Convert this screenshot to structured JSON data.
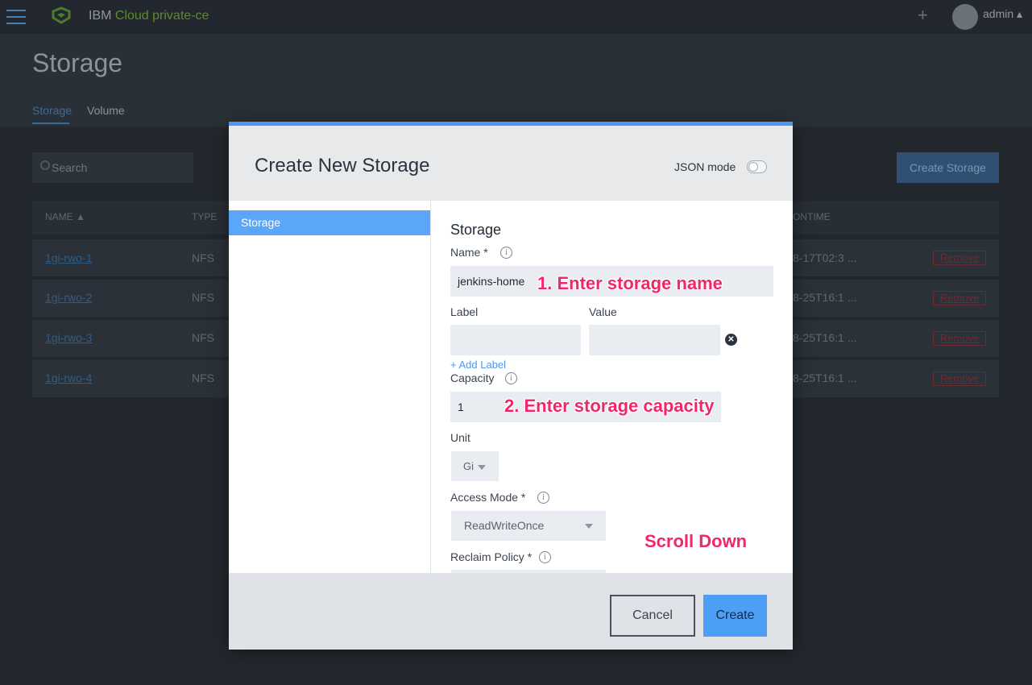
{
  "app": {
    "brand_prefix": "IBM ",
    "brand_name": "Cloud private-ce",
    "username": "admin",
    "plus_glyph": "+"
  },
  "page": {
    "title": "Storage",
    "tabs": [
      {
        "label": "Storage",
        "active": true
      },
      {
        "label": "Volume",
        "active": false
      }
    ],
    "search": {
      "placeholder": "Search"
    },
    "create_button": "Create Storage",
    "table": {
      "columns": [
        "NAME ▲",
        "TYPE",
        "ONTIME"
      ],
      "rows": [
        {
          "name": "1gi-rwo-1",
          "type": "NFS",
          "time": "8-17T02:3 ...",
          "action": "Remove"
        },
        {
          "name": "1gi-rwo-2",
          "type": "NFS",
          "time": "8-25T16:1 ...",
          "action": "Remove"
        },
        {
          "name": "1gi-rwo-3",
          "type": "NFS",
          "time": "8-25T16:1 ...",
          "action": "Remove"
        },
        {
          "name": "1gi-rwo-4",
          "type": "NFS",
          "time": "8-25T16:1 ...",
          "action": "Remove"
        }
      ]
    }
  },
  "modal": {
    "title": "Create New Storage",
    "json_mode_label": "JSON mode",
    "json_mode_on": false,
    "sidebar_items": [
      "Storage"
    ],
    "section_title": "Storage",
    "fields": {
      "name_label": "Name *",
      "name_value": "jenkins-home",
      "label_label": "Label",
      "value_label": "Value",
      "add_label": "+ Add Label",
      "capacity_label": "Capacity",
      "capacity_value": "1",
      "unit_label": "Unit",
      "unit_value": "Gi",
      "access_mode_label": "Access Mode *",
      "access_mode_value": "ReadWriteOnce",
      "reclaim_policy_label": "Reclaim Policy *"
    },
    "annotations": {
      "step1": "1. Enter storage name",
      "step2": "2. Enter storage capacity",
      "scroll": "Scroll Down"
    },
    "footer": {
      "cancel": "Cancel",
      "create": "Create"
    }
  },
  "colors": {
    "accent": "#4c9ff5",
    "annotation": "#f0286a",
    "overlay_bg": "#2a3037"
  },
  "icons": {
    "menu": "hamburger-icon",
    "logo": "logo-icon",
    "add": "plus-icon",
    "search": "search-icon",
    "info": "info-icon",
    "clear": "close-circle-icon",
    "dropdown": "chevron-down-icon"
  }
}
